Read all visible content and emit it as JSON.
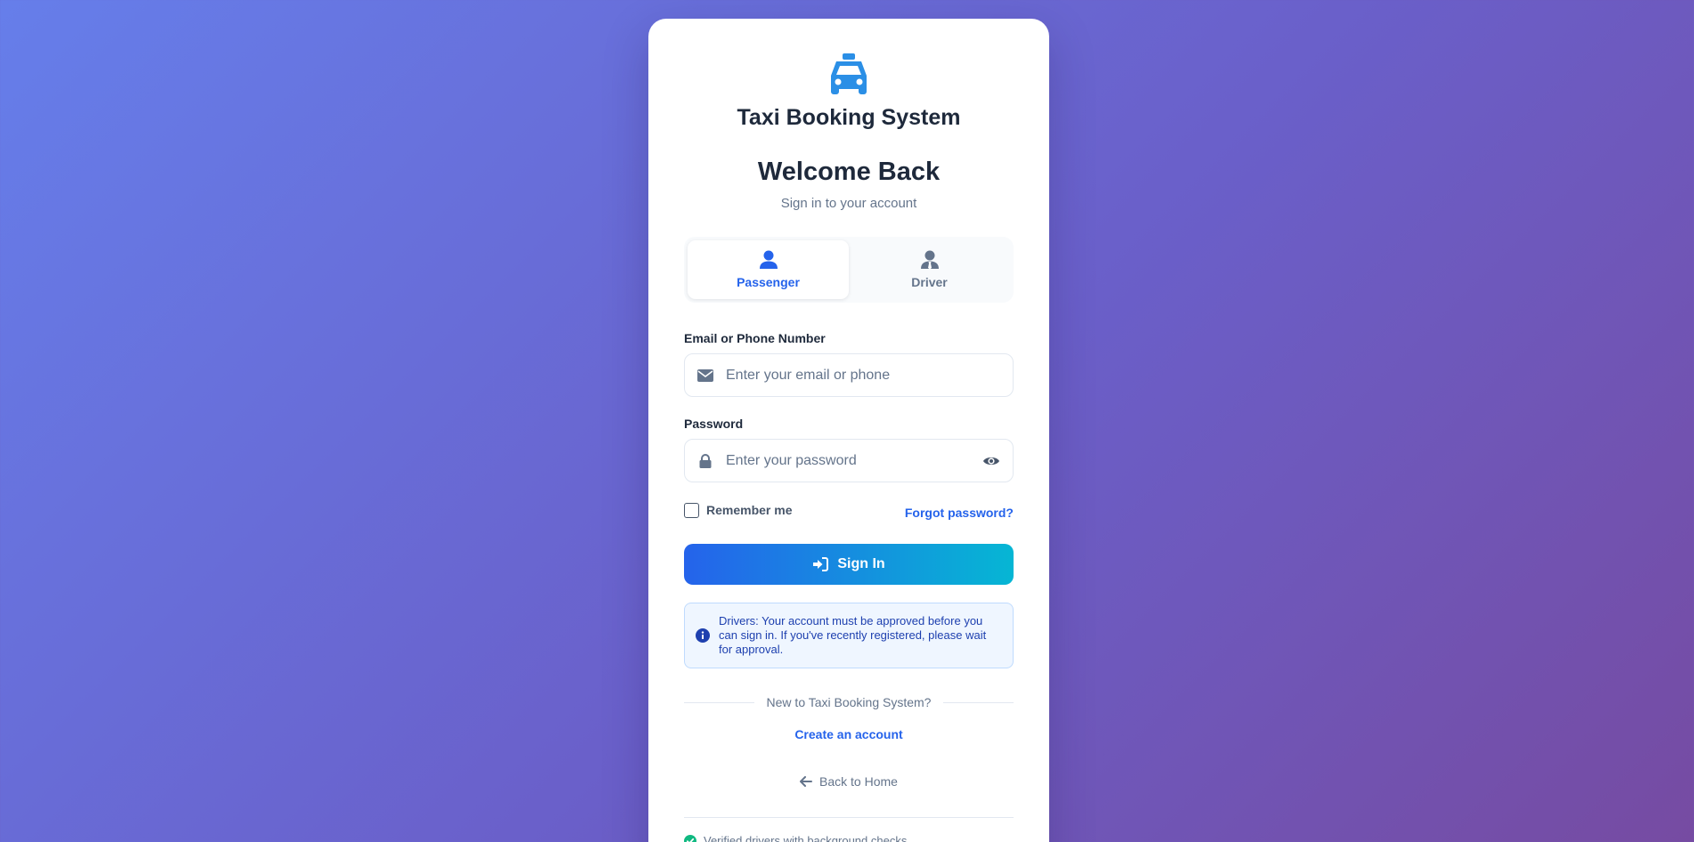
{
  "brand": {
    "name": "Taxi Booking System",
    "icon": "taxi-icon",
    "icon_color": "#2b8fe6"
  },
  "header": {
    "title": "Welcome Back",
    "subtitle": "Sign in to your account"
  },
  "role_tabs": [
    {
      "label": "Passenger",
      "icon": "user-icon",
      "active": true
    },
    {
      "label": "Driver",
      "icon": "user-tie-icon",
      "active": false
    }
  ],
  "form": {
    "email_label": "Email or Phone Number",
    "email_placeholder": "Enter your email or phone",
    "email_value": "",
    "password_label": "Password",
    "password_placeholder": "Enter your password",
    "password_value": "",
    "remember_label": "Remember me",
    "remember_checked": false,
    "forgot_label": "Forgot password?",
    "submit_label": "Sign In"
  },
  "notice": {
    "icon": "info-circle-icon",
    "text": "Drivers: Your account must be approved before you can sign in. If you've recently registered, please wait for approval."
  },
  "signup": {
    "prompt": "New to Taxi Booking System?",
    "link_label": "Create an account"
  },
  "back_link": {
    "label": "Back to Home",
    "icon": "arrow-left-icon"
  },
  "trust": {
    "text": "Verified drivers with background checks",
    "icon": "check-circle-icon"
  },
  "colors": {
    "accent": "#2563eb",
    "gradient_start": "#2563eb",
    "gradient_end": "#06b6d4",
    "background_start": "#667eea",
    "background_end": "#764ba2"
  }
}
